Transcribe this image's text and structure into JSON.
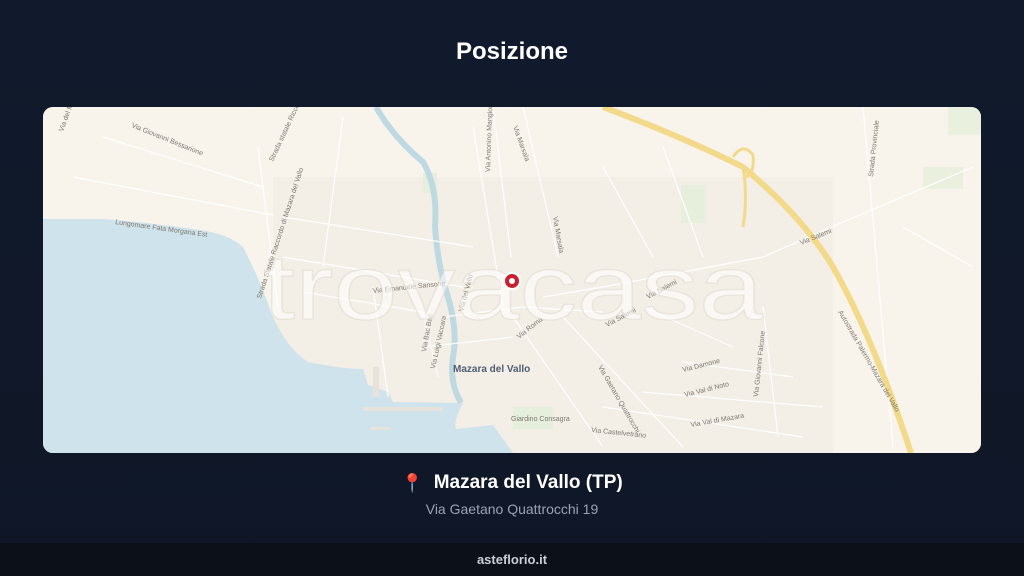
{
  "page": {
    "title": "Posizione"
  },
  "map": {
    "watermark": "trovacasa",
    "city_label": "Mazara del Vallo",
    "colors": {
      "sea": "#cfe3ec",
      "land": "#f8f4ec",
      "highway": "#f3d98a",
      "marker": "#c8202f"
    },
    "street_labels": [
      "Via del Mare",
      "Via Giovanni Bessarione",
      "Strada statale Ricco",
      "Via Antonino Mangione",
      "Via Marsala",
      "Via Marsala",
      "Via del Vallo",
      "Lungomare Fata Morgana Est",
      "Strada Statale Raccordo di Mazara del Vallo",
      "Via Emanuele Sansone",
      "Via Bac Bac",
      "Via Luigi Vaccara",
      "Via Roma",
      "Via Salemi",
      "Via Salemi",
      "Via Salemi",
      "Via Giovanni Falcone",
      "Autostrada Palermo-Mazara del Vallo",
      "Strada Provinciale",
      "Via Castelvetrano",
      "Via Val di Noto",
      "Via Val di Mazara",
      "Via Damone",
      "Giardino Consagra",
      "Via Gaetano Quattrocchi"
    ]
  },
  "location": {
    "pin_icon": "map-pin-icon",
    "city": "Mazara del Vallo (TP)",
    "address": "Via Gaetano Quattrocchi 19"
  },
  "footer": {
    "site": "asteflorio.it"
  }
}
